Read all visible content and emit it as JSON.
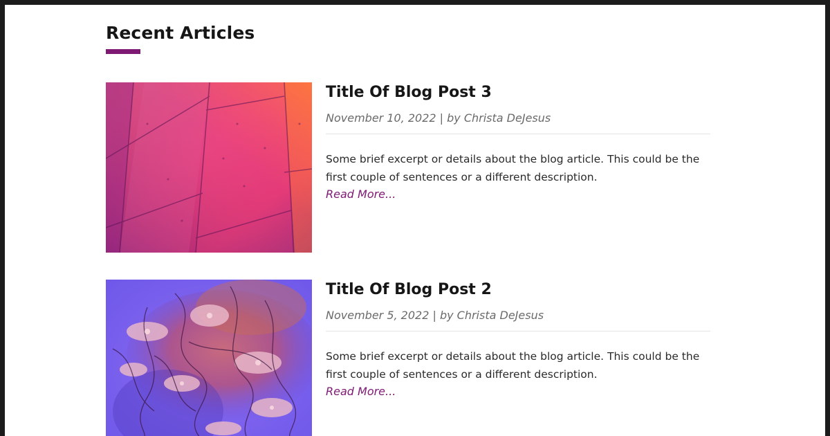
{
  "section": {
    "title": "Recent Articles",
    "accent_color": "#7e1a73"
  },
  "articles": [
    {
      "title": "Title Of Blog Post 3",
      "meta": "November 10, 2022 | by Christa DeJesus",
      "excerpt": "Some brief excerpt or details about the blog article. This could be the first couple of sentences or a different description.",
      "read_more": "Read More..."
    },
    {
      "title": "Title Of Blog Post 2",
      "meta": "November 5, 2022 | by Christa DeJesus",
      "excerpt": "Some brief excerpt or details about the blog article. This could be the first couple of sentences or a different description.",
      "read_more": "Read More..."
    }
  ]
}
